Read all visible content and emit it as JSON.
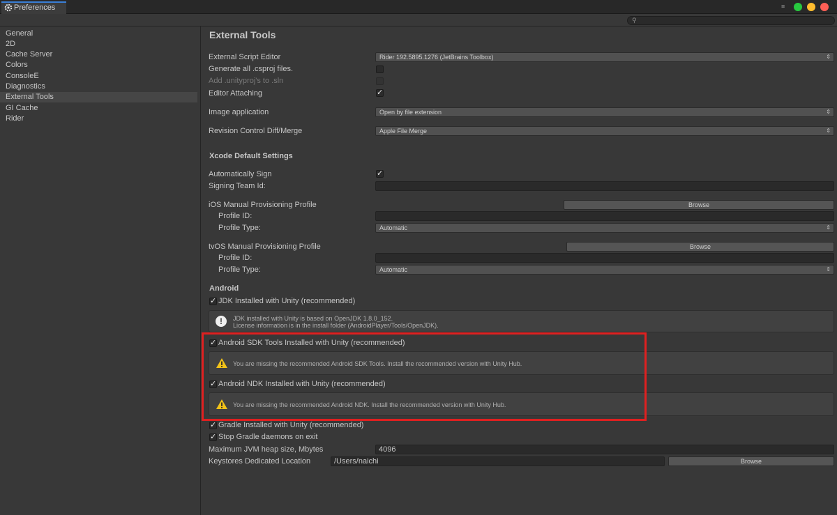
{
  "window": {
    "tab_title": "Preferences"
  },
  "colors": {
    "close": "#ff5f56",
    "minimize": "#ffbd2e",
    "maximize": "#27c93f",
    "highlight": "#e02020"
  },
  "sidebar": {
    "items": [
      {
        "label": "General"
      },
      {
        "label": "2D"
      },
      {
        "label": "Cache Server"
      },
      {
        "label": "Colors"
      },
      {
        "label": "ConsoleE"
      },
      {
        "label": "Diagnostics"
      },
      {
        "label": "External Tools"
      },
      {
        "label": "GI Cache"
      },
      {
        "label": "Rider"
      }
    ]
  },
  "main": {
    "title": "External Tools",
    "external_script_editor": {
      "label": "External Script Editor",
      "value": "Rider 192.5895.1276 (JetBrains Toolbox)"
    },
    "generate_csproj": {
      "label": "Generate all .csproj files.",
      "checked": false
    },
    "add_unityproj": {
      "label": "Add .unityproj's to .sln",
      "checked": false
    },
    "editor_attaching": {
      "label": "Editor Attaching",
      "checked": true
    },
    "image_application": {
      "label": "Image application",
      "value": "Open by file extension"
    },
    "revision_control": {
      "label": "Revision Control Diff/Merge",
      "value": "Apple File Merge"
    },
    "xcode": {
      "title": "Xcode Default Settings",
      "auto_sign": {
        "label": "Automatically Sign",
        "checked": true
      },
      "team_id": {
        "label": "Signing Team Id:",
        "value": ""
      },
      "ios_profile": {
        "label": "iOS Manual Provisioning Profile",
        "browse": "Browse",
        "id_label": "Profile ID:",
        "type_label": "Profile Type:",
        "type_value": "Automatic"
      },
      "tvos_profile": {
        "label": "tvOS Manual Provisioning Profile",
        "browse": "Browse",
        "id_label": "Profile ID:",
        "type_label": "Profile Type:",
        "type_value": "Automatic"
      }
    },
    "android": {
      "title": "Android",
      "jdk": {
        "label": "JDK Installed with Unity (recommended)",
        "checked": true,
        "info_line1": "JDK installed with Unity is based on OpenJDK 1.8.0_152.",
        "info_line2": "License information is in the install folder (AndroidPlayer/Tools/OpenJDK)."
      },
      "sdk": {
        "label": "Android SDK Tools Installed with Unity (recommended)",
        "checked": true,
        "warning": "You are missing the recommended Android SDK Tools. Install the recommended version with Unity Hub."
      },
      "ndk": {
        "label": "Android NDK Installed with Unity (recommended)",
        "checked": true,
        "warning": "You are missing the recommended Android NDK. Install the recommended version with Unity Hub."
      },
      "gradle": {
        "label": "Gradle Installed with Unity (recommended)",
        "checked": true
      },
      "stop_gradle": {
        "label": "Stop Gradle daemons on exit",
        "checked": true
      },
      "jvm_heap": {
        "label": "Maximum JVM heap size, Mbytes",
        "value": "4096"
      },
      "keystores": {
        "label": "Keystores Dedicated Location",
        "value": "/Users/naichi",
        "browse": "Browse"
      }
    }
  }
}
